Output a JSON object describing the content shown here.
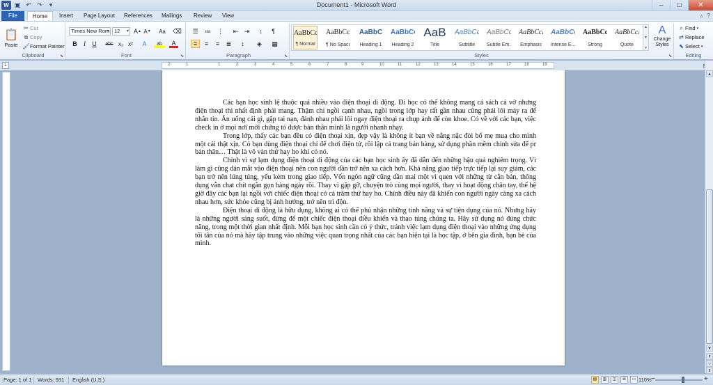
{
  "window": {
    "title": "Document1 - Microsoft Word",
    "controls": {
      "minimize": "–",
      "maximize": "□",
      "close": "✕"
    }
  },
  "quick_access": {
    "icons": [
      "word-logo-icon",
      "save-icon",
      "undo-icon",
      "redo-icon",
      "customize-icon"
    ]
  },
  "tabs": [
    {
      "label": "File",
      "active": false
    },
    {
      "label": "Home",
      "active": true
    },
    {
      "label": "Insert",
      "active": false
    },
    {
      "label": "Page Layout",
      "active": false
    },
    {
      "label": "References",
      "active": false
    },
    {
      "label": "Mailings",
      "active": false
    },
    {
      "label": "Review",
      "active": false
    },
    {
      "label": "View",
      "active": false
    }
  ],
  "ribbon": {
    "clipboard": {
      "label": "Clipboard",
      "paste": "Paste",
      "cut": "Cut",
      "copy": "Copy",
      "format_painter": "Format Painter"
    },
    "font": {
      "label": "Font",
      "font_name": "Times New Rom",
      "font_size": "12",
      "grow": "A",
      "shrink": "A",
      "case": "Aa",
      "bold": "B",
      "italic": "I",
      "underline": "U",
      "strikethrough": "abc",
      "subscript": "x₂",
      "superscript": "x²",
      "text_effects": "A",
      "highlight": "ab",
      "font_color": "A"
    },
    "paragraph": {
      "label": "Paragraph"
    },
    "styles": {
      "label": "Styles",
      "items": [
        {
          "sample": "AaBbCcI",
          "name": "¶ Normal",
          "selected": true
        },
        {
          "sample": "AaBbCcI",
          "name": "¶ No Spaci...",
          "selected": false
        },
        {
          "sample": "AaBbC",
          "name": "Heading 1",
          "selected": false
        },
        {
          "sample": "AaBbCc",
          "name": "Heading 2",
          "selected": false
        },
        {
          "sample": "AaB",
          "name": "Title",
          "selected": false
        },
        {
          "sample": "AaBbCc.",
          "name": "Subtitle",
          "selected": false
        },
        {
          "sample": "AaBbCcI",
          "name": "Subtle Em...",
          "selected": false
        },
        {
          "sample": "AaBbCcI",
          "name": "Emphasis",
          "selected": false
        },
        {
          "sample": "AaBbCc",
          "name": "Intense E...",
          "selected": false
        },
        {
          "sample": "AaBbCcI",
          "name": "Strong",
          "selected": false
        },
        {
          "sample": "AaBbCcI",
          "name": "Quote",
          "selected": false
        }
      ],
      "change_styles": "Change Styles"
    },
    "editing": {
      "label": "Editing",
      "find": "Find",
      "replace": "Replace",
      "select": "Select"
    }
  },
  "ruler": {
    "ticks": [
      "2",
      "1",
      "1",
      "2",
      "3",
      "4",
      "5",
      "6",
      "7",
      "8",
      "9",
      "10",
      "11",
      "12",
      "13",
      "14",
      "15",
      "16",
      "17",
      "18",
      "19"
    ]
  },
  "document": {
    "paragraphs": [
      "Các bạn học sinh lệ thuộc quá nhiều vào điện thoại di động. Đi học có thể không mang cả sách cả vở nhưng điện thoại thì nhất định phải mang.  Thậm chí ngồi cạnh nhau, ngồi trong lớp hay rất gần nhau cũng phải lôi máy ra để nhắn tin. Ăn uống cái gì, gặp tai nạn, đánh nhau phải lôi ngay điện thoại ra chụp ảnh để còn khoe. Có về với các bạn, việc check in ở mọi nơi mới chứng tỏ được bản thân mình là người nhanh nhạy.",
      "Trong lớp, thấy các bạn đều có điện thoại xịn, đẹp vậy là  không ít bạn về nằng nặc đòi bố mẹ mua cho mình một cái thật xịn. Có bạn dùng điện thoại chỉ để chơi điện tử, rồi lập cả trang bán hàng, sử dụng phần mềm chỉnh sửa để pr bản thân… Thật là vô vàn thứ hay ho khi có nó.",
      "Chính vì sự lạm dụng điện thoại di động của các bạn học sinh ấy đã dẫn đến những hậu quả nghiêm trọng. Vì làm gì cũng dán mắt vào điện thoại nên con người dần trở nên xa cách hơn. Khả năng giao tiếp trực tiếp lại suy giảm, các bạn trở nên lúng túng, yếu kém trong giao tiếp. Vốn ngôn ngữ cũng dần mai một vì quen với những từ cắn bản, thông dụng vẫn chat chít ngắn gọn hàng ngày rồi. Thay vì gặp gỡ, chuyện trò cùng mọi người, thay vì hoạt động chân tay, thế hệ giờ đây các bạn lại ngồi với chiếc điện thoại cỏ cả trăm thứ hay ho. Chính điều này đã khiến con người ngày càng xa cách nhau hơn, sức khỏe cũng bị ảnh hưởng, trở nên trì độn.",
      "Điện thoại di động là hữu dụng, không ai có thể phủ nhận những tính năng và sự tiện dụng của nó. Nhưng hãy là những người sáng suốt, đừng để một chiếc điện thoại điều khiển và thao túng chúng ta. Hãy sử dụng nó đúng chức năng, trong một thời gian nhất định. Mỗi bạn học sinh cần có ý thức, tránh việc lạm dụng điện thoại vào  những ứng dụng tối tân của nó mà hãy tập trung vào những việc quan trọng nhất của các bạn hiện tại là học tập, ở bên gia đình, bạn bè của mình."
    ]
  },
  "statusbar": {
    "page": "Page: 1 of 1",
    "words": "Words: 931",
    "language": "English (U.S.)",
    "zoom": "110%",
    "zoom_level": 1.1
  }
}
